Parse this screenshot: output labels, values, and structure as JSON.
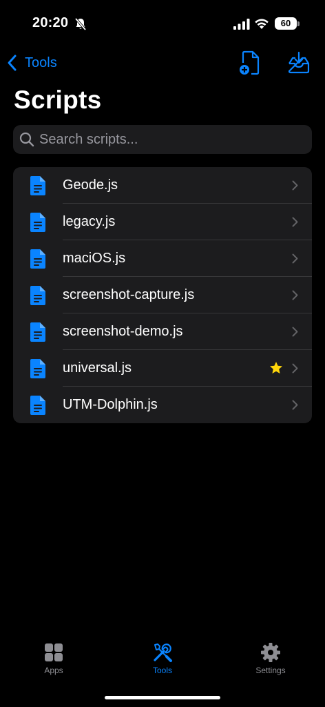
{
  "status_bar": {
    "time": "20:20",
    "battery_level": "60",
    "icons": [
      "bell-slash-icon",
      "cellular-signal-icon",
      "wifi-icon",
      "battery-icon"
    ]
  },
  "nav": {
    "back_label": "Tools",
    "actions": [
      "new-document-icon",
      "import-tray-icon"
    ]
  },
  "page": {
    "title": "Scripts"
  },
  "search": {
    "placeholder": "Search scripts..."
  },
  "scripts": [
    {
      "name": "Geode.js",
      "starred": false
    },
    {
      "name": "legacy.js",
      "starred": false
    },
    {
      "name": "maciOS.js",
      "starred": false
    },
    {
      "name": "screenshot-capture.js",
      "starred": false
    },
    {
      "name": "screenshot-demo.js",
      "starred": false
    },
    {
      "name": "universal.js",
      "starred": true
    },
    {
      "name": "UTM-Dolphin.js",
      "starred": false
    }
  ],
  "tabs": [
    {
      "label": "Apps",
      "icon": "grid-icon",
      "active": false
    },
    {
      "label": "Tools",
      "icon": "wrench-screwdriver-icon",
      "active": true
    },
    {
      "label": "Settings",
      "icon": "gear-icon",
      "active": false
    }
  ],
  "colors": {
    "accent": "#0a84ff",
    "star": "#ffd60a",
    "background": "#000000",
    "cell": "#1c1c1e",
    "inactive_tab": "#8e8e93"
  }
}
